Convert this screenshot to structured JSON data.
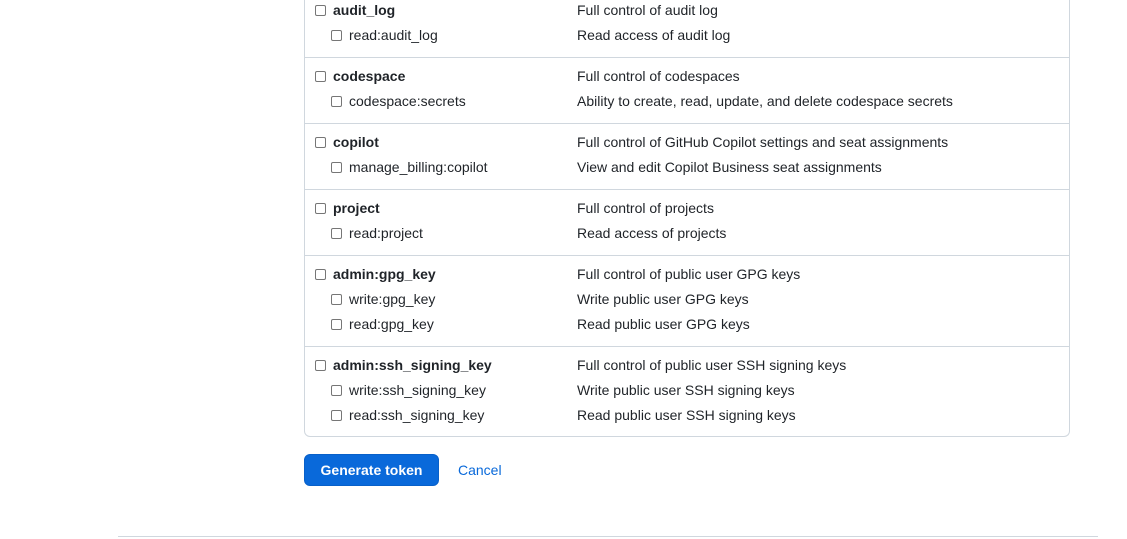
{
  "scope_groups": [
    {
      "parent": {
        "name": "audit_log",
        "description": "Full control of audit log"
      },
      "children": [
        {
          "name": "read:audit_log",
          "description": "Read access of audit log"
        }
      ]
    },
    {
      "parent": {
        "name": "codespace",
        "description": "Full control of codespaces"
      },
      "children": [
        {
          "name": "codespace:secrets",
          "description": "Ability to create, read, update, and delete codespace secrets"
        }
      ]
    },
    {
      "parent": {
        "name": "copilot",
        "description": "Full control of GitHub Copilot settings and seat assignments"
      },
      "children": [
        {
          "name": "manage_billing:copilot",
          "description": "View and edit Copilot Business seat assignments"
        }
      ]
    },
    {
      "parent": {
        "name": "project",
        "description": "Full control of projects"
      },
      "children": [
        {
          "name": "read:project",
          "description": "Read access of projects"
        }
      ]
    },
    {
      "parent": {
        "name": "admin:gpg_key",
        "description": "Full control of public user GPG keys"
      },
      "children": [
        {
          "name": "write:gpg_key",
          "description": "Write public user GPG keys"
        },
        {
          "name": "read:gpg_key",
          "description": "Read public user GPG keys"
        }
      ]
    },
    {
      "parent": {
        "name": "admin:ssh_signing_key",
        "description": "Full control of public user SSH signing keys"
      },
      "children": [
        {
          "name": "write:ssh_signing_key",
          "description": "Write public user SSH signing keys"
        },
        {
          "name": "read:ssh_signing_key",
          "description": "Read public user SSH signing keys"
        }
      ]
    }
  ],
  "actions": {
    "generate_label": "Generate token",
    "cancel_label": "Cancel"
  }
}
